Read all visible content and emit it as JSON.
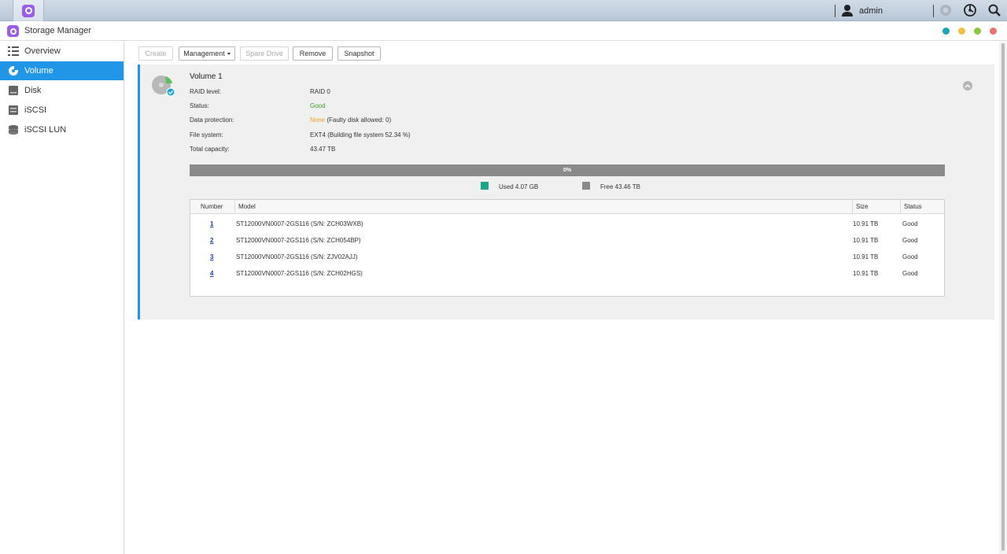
{
  "topbar": {
    "user": "admin"
  },
  "window": {
    "title": "Storage Manager",
    "dots": [
      "#1aa5b8",
      "#f0c040",
      "#8cc63e",
      "#f07070"
    ]
  },
  "sidebar": {
    "items": [
      {
        "label": "Overview",
        "icon": "overview-icon"
      },
      {
        "label": "Volume",
        "icon": "volume-icon",
        "active": true
      },
      {
        "label": "Disk",
        "icon": "disk-icon"
      },
      {
        "label": "iSCSI",
        "icon": "iscsi-icon"
      },
      {
        "label": "iSCSI LUN",
        "icon": "iscsi-lun-icon"
      }
    ]
  },
  "toolbar": {
    "create": "Create",
    "management": "Management",
    "spare_drive": "Spare Drive",
    "remove": "Remove",
    "snapshot": "Snapshot"
  },
  "volume": {
    "name": "Volume 1",
    "raid_label": "RAID level:",
    "raid_value": "RAID 0",
    "status_label": "Status:",
    "status_value": "Good",
    "protection_label": "Data protection:",
    "protection_value": "None",
    "protection_note": "(Faulty disk allowed: 0)",
    "fs_label": "File system:",
    "fs_value": "EXT4 (Building file system 52.34 %)",
    "capacity_label": "Total capacity:",
    "capacity_value": "43.47 TB",
    "usage_percent_text": "0%",
    "usage_fraction": 0.0,
    "used_legend": "Used 4.07 GB",
    "free_legend": "Free 43.46 TB",
    "used_color": "#1aa58d",
    "free_color": "#8a8a8a"
  },
  "disk_table": {
    "headers": {
      "number": "Number",
      "model": "Model",
      "size": "Size",
      "status": "Status"
    },
    "rows": [
      {
        "number": "1",
        "model": "ST12000VN0007-2GS116 (S/N: ZCH03WXB)",
        "size": "10.91 TB",
        "status": "Good"
      },
      {
        "number": "2",
        "model": "ST12000VN0007-2GS116 (S/N: ZCH054BP)",
        "size": "10.91 TB",
        "status": "Good"
      },
      {
        "number": "3",
        "model": "ST12000VN0007-2GS116 (S/N: ZJV02AJJ)",
        "size": "10.91 TB",
        "status": "Good"
      },
      {
        "number": "4",
        "model": "ST12000VN0007-2GS116 (S/N: ZCH02HGS)",
        "size": "10.91 TB",
        "status": "Good"
      }
    ]
  }
}
